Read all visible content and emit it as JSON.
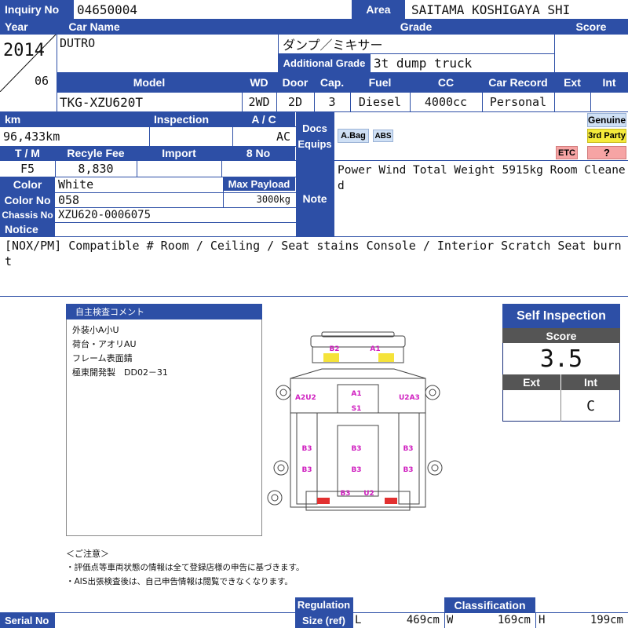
{
  "labels": {
    "inquiry_no": "Inquiry No",
    "area": "Area",
    "year": "Year",
    "car_name": "Car Name",
    "grade": "Grade",
    "score": "Score",
    "additional_grade": "Additional Grade",
    "model": "Model",
    "wd": "WD",
    "door": "Door",
    "cap": "Cap.",
    "fuel": "Fuel",
    "cc": "CC",
    "car_record": "Car Record",
    "ext": "Ext",
    "int": "Int",
    "km": "km",
    "inspection": "Inspection",
    "ac": "A / C",
    "docs_equips": "Docs\nEquips",
    "tm": "T / M",
    "recycle_fee": "Recyle Fee",
    "import": "Import",
    "eight_no": "8 No",
    "color": "Color",
    "max_payload": "Max Payload",
    "color_no": "Color No",
    "chassis_no": "Chassis No",
    "note": "Note",
    "notice": "Notice",
    "serial_no": "Serial No",
    "regulation": "Regulation",
    "size_ref": "Size (ref)",
    "classification": "Classification",
    "size_l": "L",
    "size_w": "W",
    "size_h": "H"
  },
  "vehicle": {
    "inquiry_no": "04650004",
    "area": "SAITAMA KOSHIGAYA SHI",
    "year": "2014",
    "month": "06",
    "car_name": "DUTRO",
    "grade": "ダンプ／ミキサー",
    "additional_grade": "3t dump truck",
    "model": "TKG-XZU620T",
    "wd": "2WD",
    "door": "2D",
    "cap": "3",
    "fuel": "Diesel",
    "cc": "4000cc",
    "car_record": "Personal",
    "km": "96,433km",
    "inspection": "",
    "ac": "AC",
    "tm": "F5",
    "recycle_fee": "8,830",
    "color": "White",
    "max_payload": "3000kg",
    "color_no": "058",
    "chassis_no": "XZU620-0006075",
    "note": "Power Wind Total Weight 5915kg Room Cleaned",
    "notice": "[NOX/PM] Compatible # Room / Ceiling / Seat stains Console / Interior Scratch Seat burnt"
  },
  "equips": {
    "abag": "A.Bag",
    "abs": "ABS",
    "genuine": "Genuine",
    "third_party": "3rd Party",
    "etc": "ETC",
    "question": "?"
  },
  "self_comment": {
    "title": "自主検査コメント",
    "lines": [
      "外装小A小U",
      "荷台・アオリAU",
      "フレーム表面錆",
      "極東開発製　DD02－31"
    ]
  },
  "diagram_marks": {
    "b2": "B2",
    "a1_front": "A1",
    "a2u2": "A2U2",
    "a1": "A1",
    "s1": "S1",
    "u2a3": "U2A3",
    "b3_l1": "B3",
    "b3_l2": "B3",
    "b3_c1": "B3",
    "b3_c2": "B3",
    "b3_r1": "B3",
    "b3_r2": "B3",
    "b3_bottom": "B3",
    "u2_bottom": "U2"
  },
  "notes": {
    "title": "＜ご注意＞",
    "lines": [
      "・評価点等車両状態の情報は全て登録店様の申告に基づきます。",
      "・AIS出張検査後は、自己申告情報は閲覧できなくなります。"
    ]
  },
  "self_inspection": {
    "title": "Self Inspection",
    "score_label": "Score",
    "score": "3.5",
    "ext_label": "Ext",
    "int_label": "Int",
    "ext": "",
    "int": "C"
  },
  "size": {
    "l": "469cm",
    "w": "169cm",
    "h": "199cm"
  },
  "colors": {
    "header_blue": "#2d4fa6",
    "dark_blue": "#1a2f7a",
    "score_gray": "#555555"
  }
}
